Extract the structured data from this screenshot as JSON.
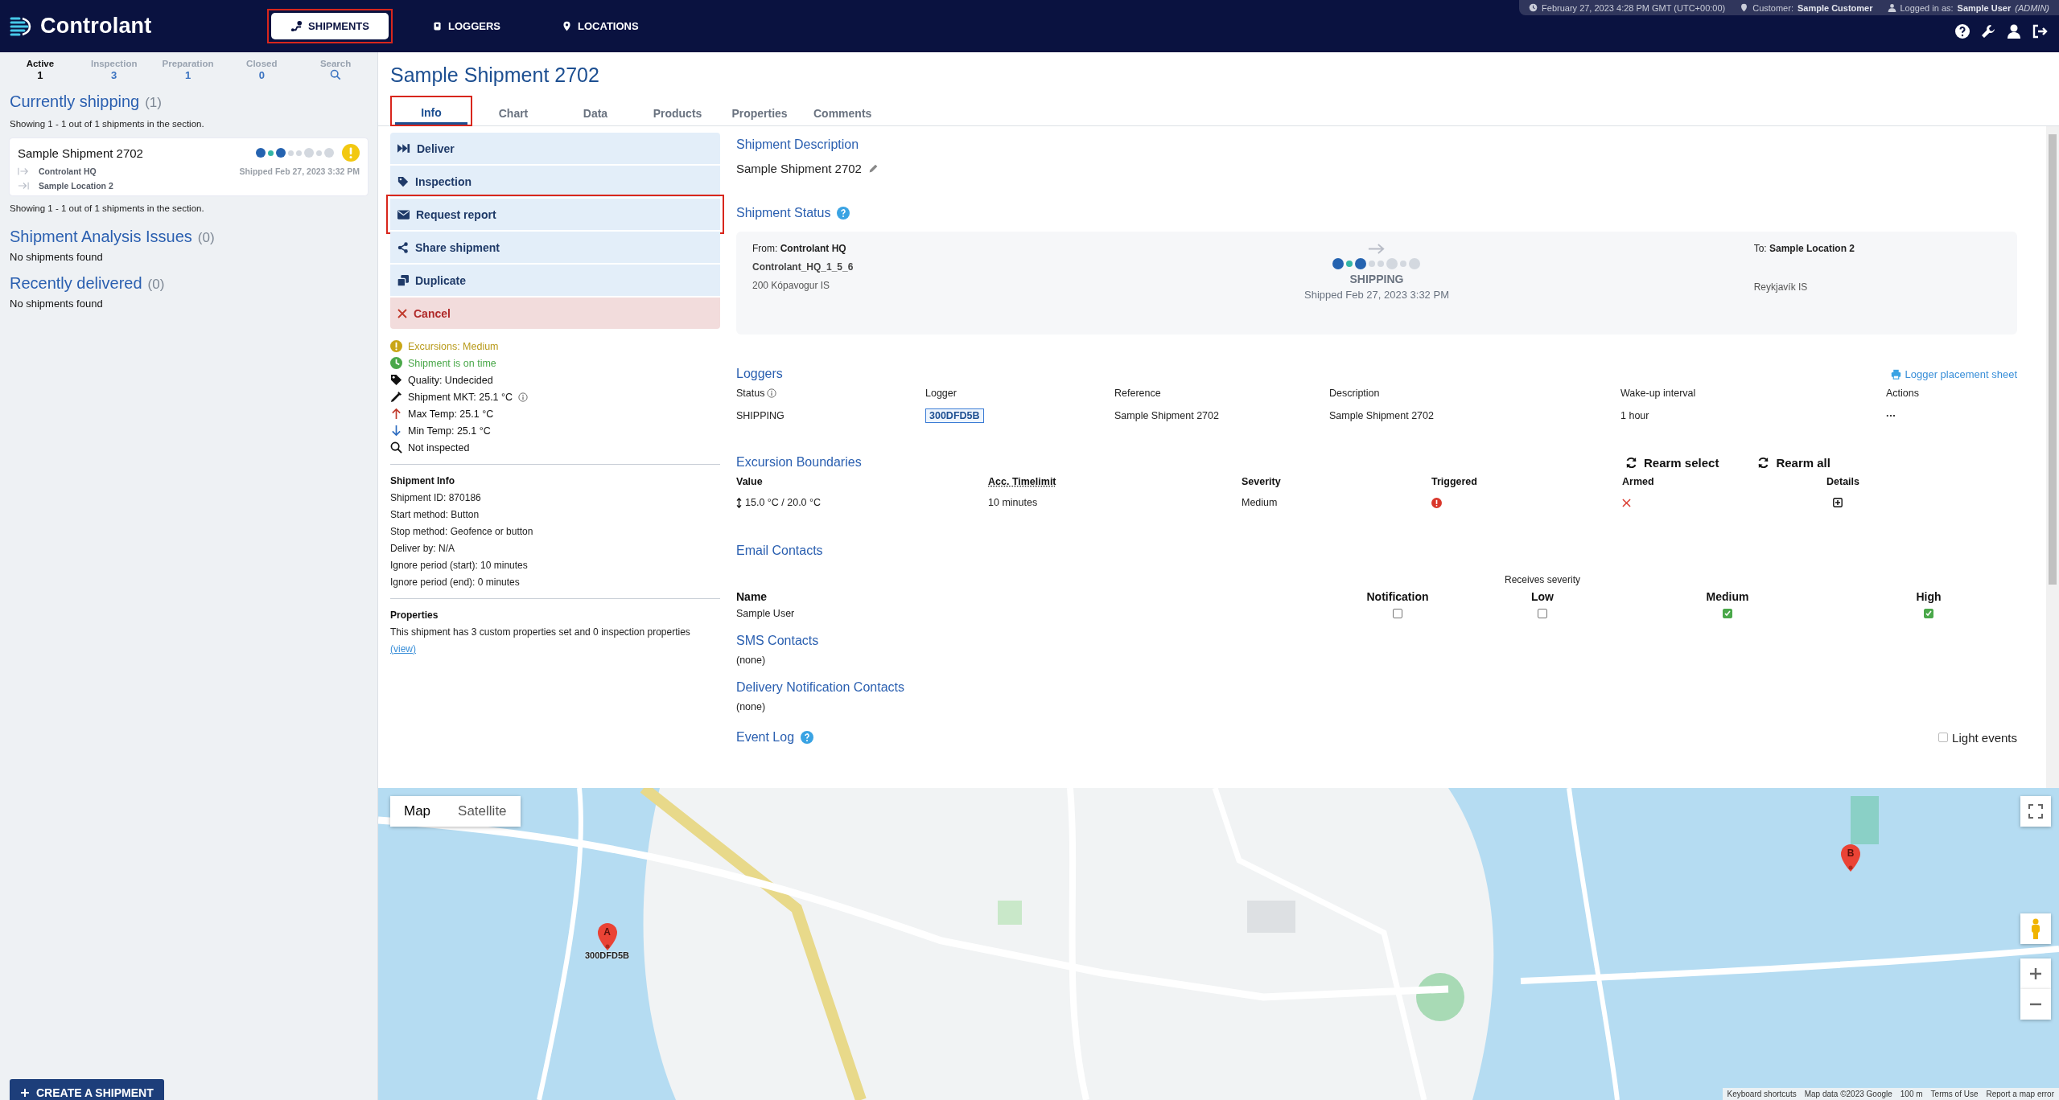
{
  "app": {
    "name": "Controlant"
  },
  "nav": [
    {
      "label": "SHIPMENTS",
      "kind": "shipments",
      "selected": true,
      "annotated": true
    },
    {
      "label": "LOGGERS",
      "kind": "loggers",
      "selected": false,
      "annotated": false
    },
    {
      "label": "LOCATIONS",
      "kind": "locations",
      "selected": false,
      "annotated": false
    }
  ],
  "session": {
    "datetime": "February 27, 2023 4:28 PM GMT (UTC+00:00)",
    "customer": "Customer: **Sample Customer**",
    "login": "Logged in as: **Sample User** *(ADMIN)*"
  },
  "sidebar": {
    "counters": [
      {
        "label": "Active",
        "kind": "count",
        "value": "1",
        "selected": true
      },
      {
        "label": "Inspection",
        "kind": "count",
        "value": "3",
        "selected": false
      },
      {
        "label": "Preparation",
        "kind": "count",
        "value": "1",
        "selected": false
      },
      {
        "label": "Closed",
        "kind": "count",
        "value": "0",
        "selected": false
      },
      {
        "label": "Search",
        "kind": "search",
        "selected": false
      }
    ],
    "sections": [
      {
        "title": "Currently shipping",
        "count": "(1)",
        "summary": "Showing 1 - 1 out of 1 shipments in the section.",
        "shipments": [
          {
            "name": "Sample Shipment 2702",
            "origin": "Controlant HQ",
            "destination": "Sample Location 2",
            "shipped": "Shipped Feb 27, 2023 3:32 PM",
            "warning": true
          }
        ],
        "footer": "Showing 1 - 1 out of 1 shipments in the section."
      },
      {
        "title": "Shipment Analysis Issues",
        "count": "(0)",
        "empty": "No shipments found"
      },
      {
        "title": "Recently delivered",
        "count": "(0)",
        "empty": "No shipments found"
      }
    ],
    "create_button": "CREATE A SHIPMENT"
  },
  "progress": [
    {
      "kind": "stop",
      "reached": true
    },
    {
      "kind": "leg",
      "reached": true
    },
    {
      "kind": "stop",
      "reached": true
    },
    {
      "kind": "leg",
      "reached": false
    },
    {
      "kind": "leg",
      "reached": false
    },
    {
      "kind": "stop",
      "reached": false
    },
    {
      "kind": "leg",
      "reached": false
    },
    {
      "kind": "stop",
      "reached": false
    }
  ],
  "shipment": {
    "title": "Sample Shipment 2702",
    "tabs": [
      {
        "label": "Info",
        "selected": true,
        "annotated": true
      },
      {
        "label": "Chart",
        "selected": false,
        "annotated": false
      },
      {
        "label": "Data",
        "selected": false,
        "annotated": false
      },
      {
        "label": "Products",
        "selected": false,
        "annotated": false
      },
      {
        "label": "Properties",
        "selected": false,
        "annotated": false
      },
      {
        "label": "Comments",
        "selected": false,
        "annotated": false
      }
    ],
    "actions": [
      {
        "label": "Deliver",
        "kind": "deliver",
        "annotated": false
      },
      {
        "label": "Inspection",
        "kind": "inspection",
        "annotated": false
      },
      {
        "label": "Request report",
        "kind": "report",
        "annotated": true
      },
      {
        "label": "Share shipment",
        "kind": "share",
        "annotated": false
      },
      {
        "label": "Duplicate",
        "kind": "duplicate",
        "annotated": false
      },
      {
        "label": "Cancel",
        "kind": "cancel",
        "annotated": false
      }
    ],
    "indicators": [
      {
        "kind": "excursion",
        "text": "Excursions: Medium"
      },
      {
        "kind": "ontime",
        "text": "Shipment is on time"
      },
      {
        "kind": "quality",
        "text": "Quality: Undecided"
      },
      {
        "kind": "mkt",
        "text": "Shipment MKT: 25.1 °C"
      },
      {
        "kind": "max",
        "text": "Max Temp: 25.1 °C"
      },
      {
        "kind": "min",
        "text": "Min Temp: 25.1 °C"
      },
      {
        "kind": "inspect",
        "text": "Not inspected"
      }
    ],
    "info": {
      "title": "Shipment Info",
      "lines": [
        "Shipment ID: 870186",
        "Start method: Button",
        "Stop method: Geofence or button",
        "Deliver by: N/A",
        "Ignore period (start): 10 minutes",
        "Ignore period (end): 0 minutes"
      ]
    },
    "properties": {
      "title": "Properties",
      "text": "This shipment has 3 custom properties set and 0 inspection properties",
      "link": "(view)"
    },
    "description": {
      "title": "Shipment Description",
      "value": "Sample Shipment 2702"
    },
    "status": {
      "title": "Shipment Status",
      "from_label": "From:",
      "from": "Controlant HQ",
      "from_code": "Controlant_HQ_1_5_6",
      "from_address": "200 Kópavogur IS",
      "state": "SHIPPING",
      "shipped": "Shipped Feb 27, 2023 3:32 PM",
      "to_label": "To:",
      "to": "Sample Location 2",
      "to_address": "Reykjavík IS"
    },
    "loggers": {
      "title": "Loggers",
      "link": "Logger placement sheet",
      "columns": [
        "Status",
        "Logger",
        "Reference",
        "Description",
        "Wake-up interval",
        "Actions"
      ],
      "rows": [
        [
          "SHIPPING",
          "300DFD5B",
          "Sample Shipment 2702",
          "Sample Shipment 2702",
          "1 hour",
          "···"
        ]
      ]
    },
    "excursions": {
      "title": "Excursion Boundaries",
      "buttons": [
        "Rearm select",
        "Rearm all"
      ],
      "columns": [
        "Value",
        "Acc. Timelimit",
        "Severity",
        "Triggered",
        "Armed",
        "Details"
      ],
      "rows": [
        {
          "value": "15.0 °C / 20.0 °C",
          "timelimit": "10 minutes",
          "severity": "Medium",
          "triggered": true,
          "armed": false
        }
      ]
    },
    "email": {
      "title": "Email Contacts",
      "group_label": "Receives severity",
      "columns": [
        "Name",
        "Notification",
        "Low",
        "Medium",
        "High"
      ],
      "rows": [
        {
          "name": "Sample User",
          "checks": [
            false,
            false,
            true,
            true
          ]
        }
      ]
    },
    "sms": {
      "title": "SMS Contacts",
      "empty": "(none)"
    },
    "delivery": {
      "title": "Delivery Notification Contacts",
      "empty": "(none)"
    },
    "event_log": {
      "title": "Event Log",
      "light_events": {
        "label": "Light events",
        "checked": false
      }
    }
  },
  "map": {
    "kind": "picture",
    "types": [
      {
        "label": "Map",
        "selected": true
      },
      {
        "label": "Satellite",
        "selected": false
      }
    ],
    "markers": [
      {
        "letter": "A",
        "label": "300DFD5B"
      },
      {
        "letter": "B"
      }
    ],
    "footer": [
      "Keyboard shortcuts",
      "Map data ©2023 Google",
      "100 m",
      "Terms of Use",
      "Report a map error"
    ]
  }
}
